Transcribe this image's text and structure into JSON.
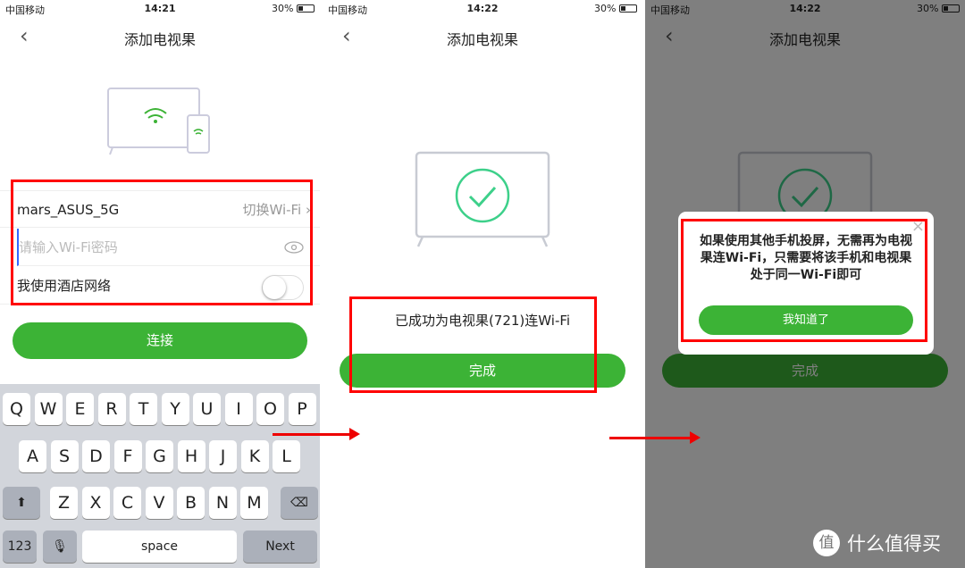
{
  "status": [
    {
      "carrier": "中国移动",
      "time": "14:21",
      "battery": "30%"
    },
    {
      "carrier": "中国移动",
      "time": "14:22",
      "battery": "30%"
    },
    {
      "carrier": "中国移动",
      "time": "14:22",
      "battery": "30%"
    }
  ],
  "nav": {
    "title": "添加电视果",
    "back": "‹"
  },
  "screen1": {
    "ssid": "mars_ASUS_5G",
    "switch_wifi": "切换Wi-Fi ›",
    "password_placeholder": "请输入Wi-Fi密码",
    "hotel_label": "我使用酒店网络",
    "hotel_toggle": false,
    "connect": "连接"
  },
  "keyboard": {
    "row1": [
      "Q",
      "W",
      "E",
      "R",
      "T",
      "Y",
      "U",
      "I",
      "O",
      "P"
    ],
    "row2": [
      "A",
      "S",
      "D",
      "F",
      "G",
      "H",
      "J",
      "K",
      "L"
    ],
    "row3": [
      "Z",
      "X",
      "C",
      "V",
      "B",
      "N",
      "M"
    ],
    "num": "123",
    "space": "space",
    "next": "Next",
    "shift": "⬆",
    "delete": "⌫",
    "mic": "🎙"
  },
  "screen2": {
    "success": "已成功为电视果(721)连Wi-Fi",
    "done": "完成"
  },
  "screen3": {
    "dialog_text": "如果使用其他手机投屏，无需再为电视果连Wi-Fi，只需要将该手机和电视果处于同一Wi-Fi即可",
    "ok": "我知道了",
    "done": "完成",
    "close": "×"
  },
  "watermark": {
    "logo": "值",
    "text": "什么值得买"
  },
  "colors": {
    "accent": "#3cb336",
    "highlight": "#ff0000"
  }
}
